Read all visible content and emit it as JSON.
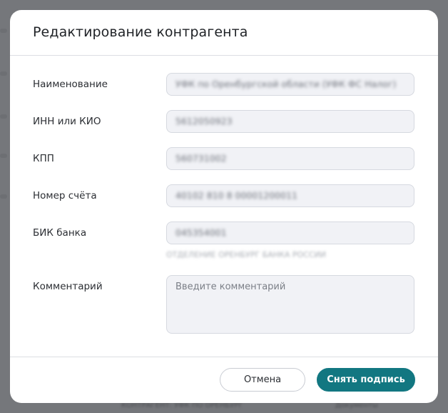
{
  "modal": {
    "title": "Редактирование контрагента"
  },
  "form": {
    "name": {
      "label": "Наименование",
      "value": "УФК по Оренбургской области (УФК ФС Налог)"
    },
    "inn": {
      "label": "ИНН или КИО",
      "value": "5612050923"
    },
    "kpp": {
      "label": "КПП",
      "value": "560731002"
    },
    "account": {
      "label": "Номер счёта",
      "value": "40102 810 8 00001200011"
    },
    "bik": {
      "label": "БИК банка",
      "value": "045354001",
      "bank_name": "ОТДЕЛЕНИЕ ОРЕНБУРГ БАНКА РОССИИ"
    },
    "comment": {
      "label": "Комментарий",
      "placeholder": "Введите комментарий",
      "value": ""
    }
  },
  "footer": {
    "cancel_label": "Отмена",
    "submit_label": "Снять подпись"
  },
  "background": {
    "footer_left": "КОНТРАГЕНТ: УФК ПО ОРЕНБУРГ",
    "footer_right": "Документы"
  }
}
